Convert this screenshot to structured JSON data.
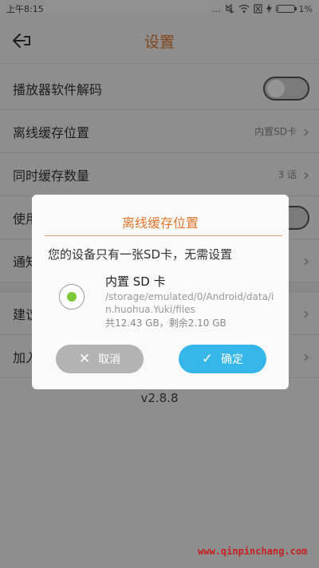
{
  "status_bar": {
    "time": "上午8:15",
    "dots": "...",
    "battery_percent_text": "1%",
    "battery_level": 0.01
  },
  "app_bar": {
    "title": "设置",
    "back_icon": "back-arrow-icon"
  },
  "settings": {
    "rows": [
      {
        "label": "播放器软件解码",
        "control": "toggle",
        "on": false
      },
      {
        "label": "离线缓存位置",
        "value": "内置SD卡",
        "control": "chevron"
      },
      {
        "label": "同时缓存数量",
        "value": "3 话",
        "control": "chevron"
      },
      {
        "label": "使用",
        "control": "toggle",
        "on": false
      },
      {
        "label": "通知",
        "control": "chevron"
      },
      {
        "label": "建议",
        "control": "chevron"
      },
      {
        "label": "加入",
        "control": "chevron"
      }
    ],
    "chevron": "›",
    "version": "v2.8.8"
  },
  "dialog": {
    "title": "离线缓存位置",
    "message": "您的设备只有一张SD卡，无需设置",
    "option": {
      "title": "内置 SD 卡",
      "path": "/storage/emulated/0/Android/data/in.huohua.Yuki/files",
      "size": "共12.43 GB，剩余2.10 GB",
      "selected": true
    },
    "cancel_label": "取消",
    "ok_label": "确定",
    "cancel_icon": "✕",
    "ok_icon": "✓"
  },
  "colors": {
    "accent_orange": "#e2752a",
    "confirm_blue": "#35b7ea",
    "cancel_gray": "#b3b3b3",
    "radio_green": "#7ec738",
    "watermark_red": "#c62020"
  },
  "watermark": "www.qinpinchang.com"
}
